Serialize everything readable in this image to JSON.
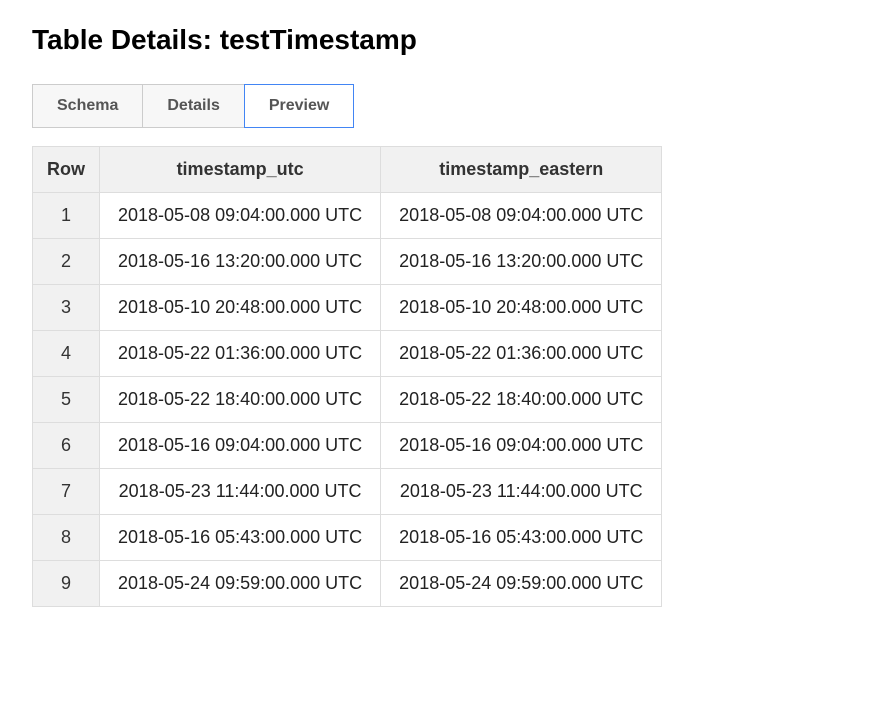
{
  "header": {
    "title_prefix": "Table Details: ",
    "table_name": "testTimestamp"
  },
  "tabs": [
    {
      "label": "Schema",
      "active": false
    },
    {
      "label": "Details",
      "active": false
    },
    {
      "label": "Preview",
      "active": true
    }
  ],
  "table": {
    "columns": [
      "Row",
      "timestamp_utc",
      "timestamp_eastern"
    ],
    "rows": [
      {
        "n": "1",
        "timestamp_utc": "2018-05-08 09:04:00.000 UTC",
        "timestamp_eastern": "2018-05-08 09:04:00.000 UTC"
      },
      {
        "n": "2",
        "timestamp_utc": "2018-05-16 13:20:00.000 UTC",
        "timestamp_eastern": "2018-05-16 13:20:00.000 UTC"
      },
      {
        "n": "3",
        "timestamp_utc": "2018-05-10 20:48:00.000 UTC",
        "timestamp_eastern": "2018-05-10 20:48:00.000 UTC"
      },
      {
        "n": "4",
        "timestamp_utc": "2018-05-22 01:36:00.000 UTC",
        "timestamp_eastern": "2018-05-22 01:36:00.000 UTC"
      },
      {
        "n": "5",
        "timestamp_utc": "2018-05-22 18:40:00.000 UTC",
        "timestamp_eastern": "2018-05-22 18:40:00.000 UTC"
      },
      {
        "n": "6",
        "timestamp_utc": "2018-05-16 09:04:00.000 UTC",
        "timestamp_eastern": "2018-05-16 09:04:00.000 UTC"
      },
      {
        "n": "7",
        "timestamp_utc": "2018-05-23 11:44:00.000 UTC",
        "timestamp_eastern": "2018-05-23 11:44:00.000 UTC"
      },
      {
        "n": "8",
        "timestamp_utc": "2018-05-16 05:43:00.000 UTC",
        "timestamp_eastern": "2018-05-16 05:43:00.000 UTC"
      },
      {
        "n": "9",
        "timestamp_utc": "2018-05-24 09:59:00.000 UTC",
        "timestamp_eastern": "2018-05-24 09:59:00.000 UTC"
      }
    ]
  }
}
